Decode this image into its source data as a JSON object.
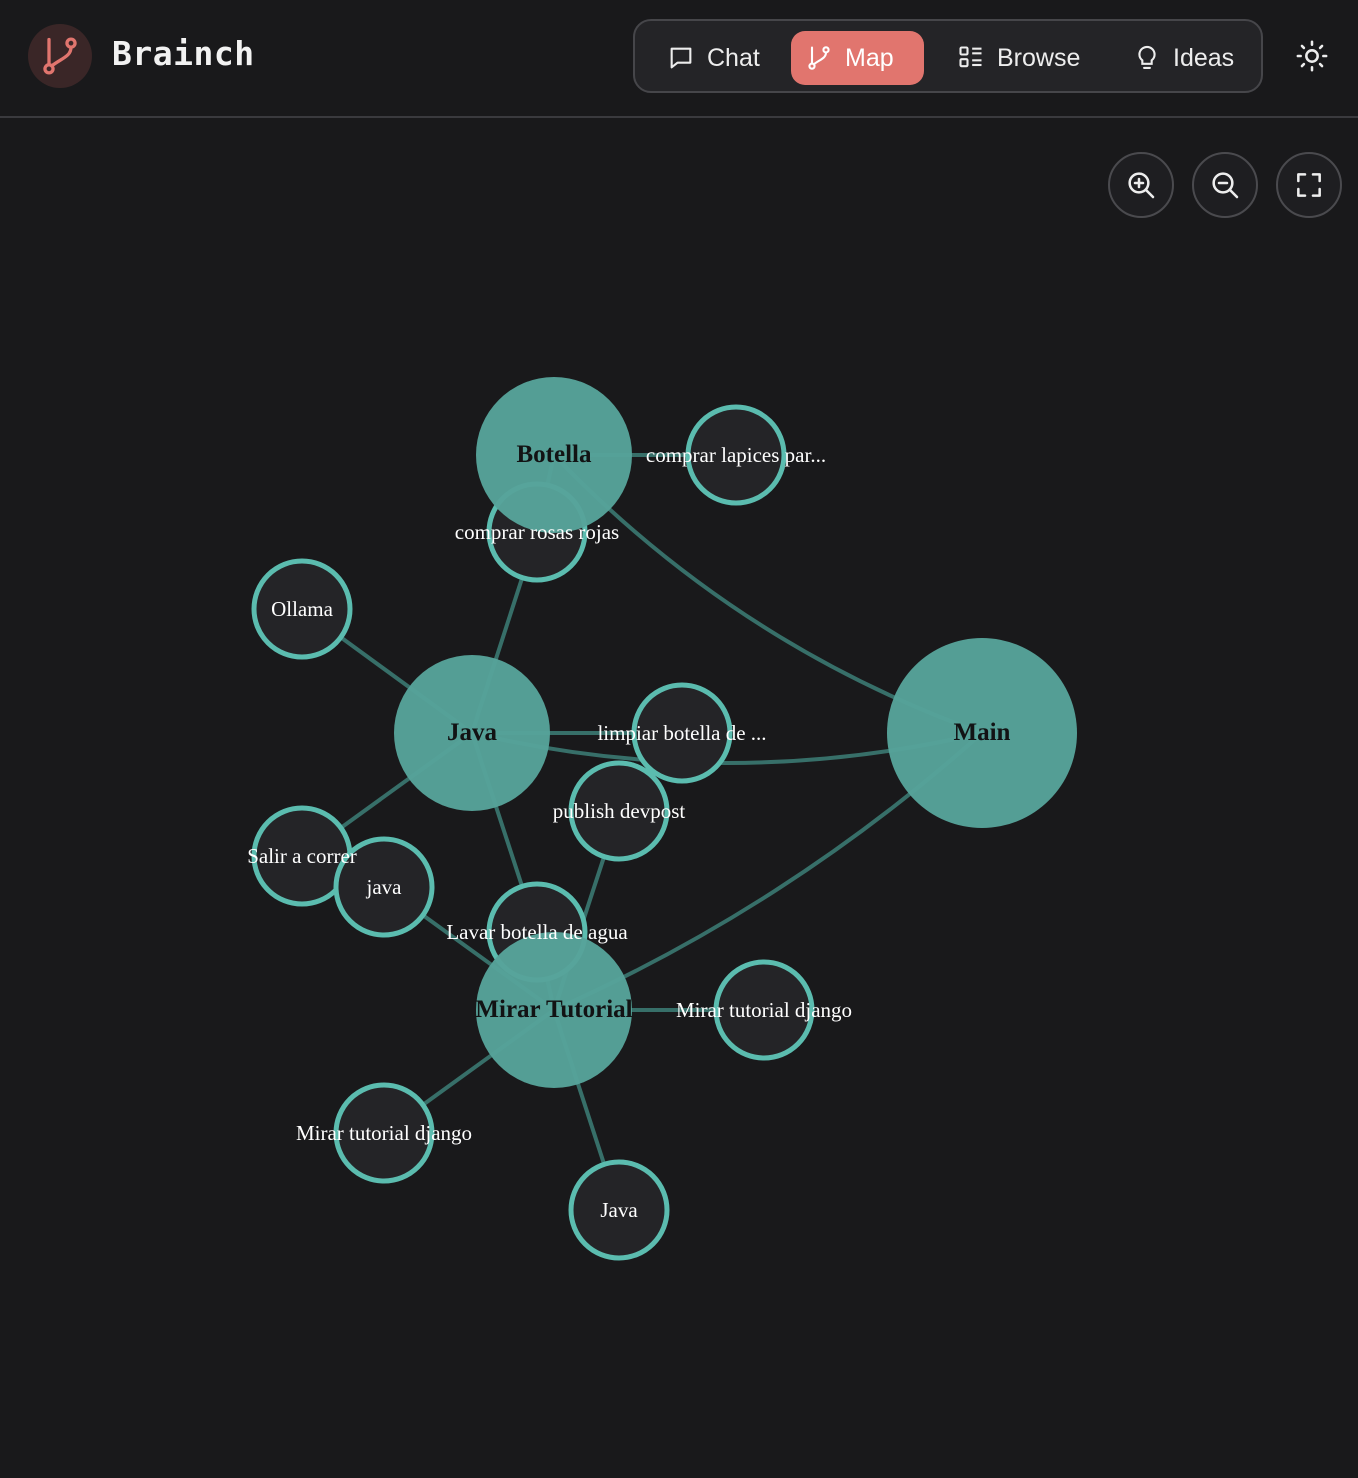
{
  "app": {
    "name": "Brainch"
  },
  "nav": {
    "items": [
      {
        "label": "Chat",
        "icon": "chat-bubble-icon",
        "active": false
      },
      {
        "label": "Map",
        "icon": "branch-icon",
        "active": true
      },
      {
        "label": "Browse",
        "icon": "list-grid-icon",
        "active": false
      },
      {
        "label": "Ideas",
        "icon": "lightbulb-icon",
        "active": false
      }
    ]
  },
  "toolbar": {
    "theme_toggle": "sun-icon",
    "controls": [
      "zoom-in-icon",
      "zoom-out-icon",
      "fullscreen-icon"
    ]
  },
  "colors": {
    "background": "#19191b",
    "accent": "#e1756e",
    "node": "#57a39a",
    "node_stroke": "#5bbcaf",
    "edge": "#3d7f77",
    "leaf_fill": "#242427"
  },
  "graph": {
    "nodes": [
      {
        "id": "botella",
        "label": "Botella",
        "type": "hub"
      },
      {
        "id": "main",
        "label": "Main",
        "type": "hub"
      },
      {
        "id": "java_hub",
        "label": "Java",
        "type": "hub"
      },
      {
        "id": "mirar",
        "label": "Mirar Tutorial",
        "type": "hub"
      },
      {
        "id": "lapices",
        "label": "comprar lapices par...",
        "type": "leaf"
      },
      {
        "id": "rosas",
        "label": "comprar rosas rojas",
        "type": "leaf"
      },
      {
        "id": "ollama",
        "label": "Ollama",
        "type": "leaf"
      },
      {
        "id": "limpiar",
        "label": "limpiar botella de ...",
        "type": "leaf"
      },
      {
        "id": "devpost",
        "label": "publish devpost",
        "type": "leaf"
      },
      {
        "id": "correr",
        "label": "Salir a correr",
        "type": "leaf"
      },
      {
        "id": "java_leaf",
        "label": "java",
        "type": "leaf"
      },
      {
        "id": "lavar",
        "label": "Lavar botella de agua",
        "type": "leaf"
      },
      {
        "id": "django1",
        "label": "Mirar tutorial django",
        "type": "leaf"
      },
      {
        "id": "django2",
        "label": "Mirar tutorial django",
        "type": "leaf"
      },
      {
        "id": "java_leaf2",
        "label": "Java",
        "type": "leaf"
      }
    ],
    "edges": [
      [
        "botella",
        "main"
      ],
      [
        "botella",
        "lapices"
      ],
      [
        "botella",
        "rosas"
      ],
      [
        "rosas",
        "java_hub"
      ],
      [
        "ollama",
        "java_hub"
      ],
      [
        "java_hub",
        "main"
      ],
      [
        "java_hub",
        "limpiar"
      ],
      [
        "java_hub",
        "correr"
      ],
      [
        "java_hub",
        "lavar"
      ],
      [
        "mirar",
        "main"
      ],
      [
        "mirar",
        "devpost"
      ],
      [
        "mirar",
        "java_leaf"
      ],
      [
        "mirar",
        "lavar"
      ],
      [
        "mirar",
        "django1"
      ],
      [
        "mirar",
        "django2"
      ],
      [
        "mirar",
        "java_leaf2"
      ]
    ]
  }
}
